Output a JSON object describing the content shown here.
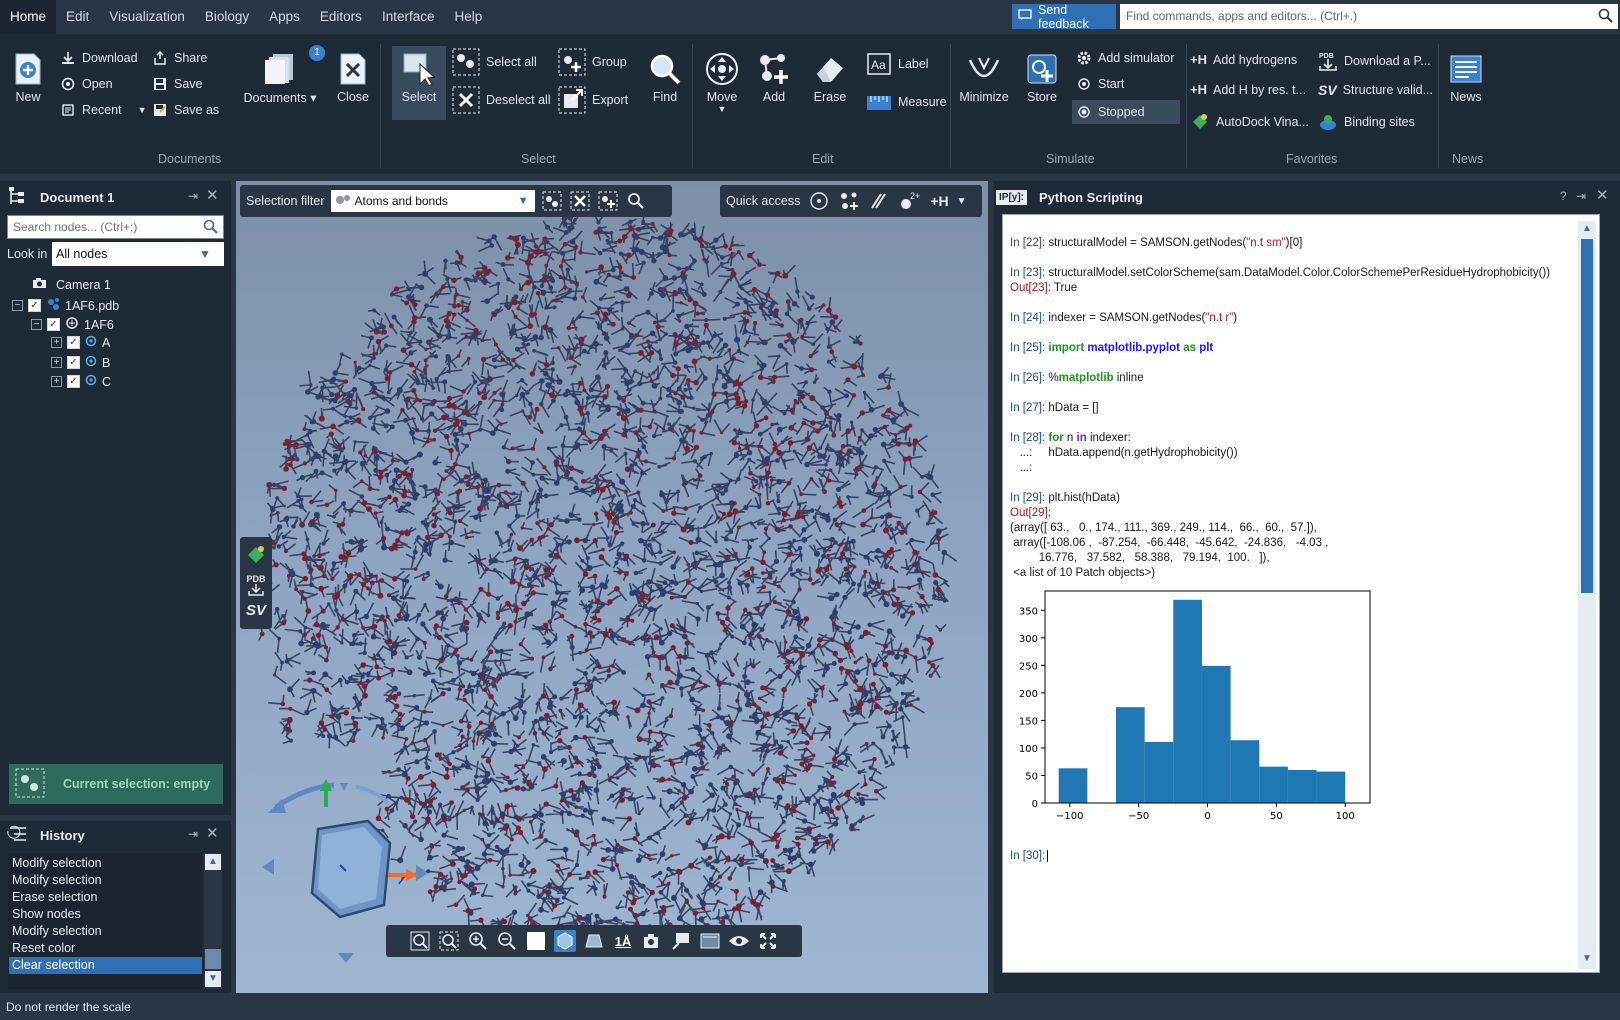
{
  "menubar": {
    "items": [
      "Home",
      "Edit",
      "Visualization",
      "Biology",
      "Apps",
      "Editors",
      "Interface",
      "Help"
    ],
    "active": "Home"
  },
  "feedback_label": "Send feedback",
  "command_placeholder": "Find commands, apps and editors... (Ctrl+.)",
  "ribbon": {
    "documents": {
      "new": "New",
      "download": "Download",
      "open": "Open",
      "recent": "Recent",
      "share": "Share",
      "save": "Save",
      "save_as": "Save as",
      "documents": "Documents",
      "close": "Close",
      "badge": "1",
      "group": "Documents"
    },
    "select": {
      "select": "Select",
      "select_all": "Select all",
      "deselect_all": "Deselect all",
      "group_btn": "Group",
      "export": "Export",
      "find": "Find",
      "group": "Select"
    },
    "edit": {
      "move": "Move",
      "add": "Add",
      "erase": "Erase",
      "label": "Label",
      "measure": "Measure",
      "group": "Edit"
    },
    "simulate": {
      "minimize": "Minimize",
      "store": "Store",
      "add_simulator": "Add simulator",
      "start": "Start",
      "stopped": "Stopped",
      "group": "Simulate"
    },
    "favorites": {
      "add_hydrogens": "Add hydrogens",
      "add_h_res": "Add H by res. t...",
      "autodock": "AutoDock Vina...",
      "download_pdb": "Download a P...",
      "structure_valid": "Structure valid...",
      "binding_sites": "Binding sites",
      "group": "Favorites"
    },
    "news": {
      "news": "News",
      "group": "News"
    }
  },
  "document_panel": {
    "title": "Document 1",
    "search_placeholder": "Search nodes... (Ctrl+;)",
    "look_in_label": "Look in",
    "look_in_value": "All nodes",
    "tree": {
      "camera": "Camera 1",
      "file": "1AF6.pdb",
      "model": "1AF6",
      "chains": [
        "A",
        "B",
        "C"
      ]
    },
    "current_selection": "Current selection: empty"
  },
  "history_panel": {
    "title": "History",
    "items": [
      "Modify selection",
      "Modify selection",
      "Erase selection",
      "Show nodes",
      "Modify selection",
      "Reset color",
      "Clear selection"
    ],
    "selected_index": 6
  },
  "viewport": {
    "selection_filter_label": "Selection filter",
    "selection_filter_value": "Atoms and bonds",
    "quick_access_label": "Quick access",
    "quick_access_charge": "2+",
    "quick_access_h": "+H",
    "side_pdb": "PDB",
    "side_sv": "SV",
    "bottom_scale_label": "1Å"
  },
  "python_panel": {
    "title": "Python Scripting",
    "icon_text": "IP[y]:",
    "cells": {
      "c22": {
        "prompt": "In [22]:",
        "pre": " structuralModel = SAMSON.getNodes(",
        "str": "\"n.t sm\"",
        "post": ")[0]"
      },
      "c23": {
        "prompt": "In [23]:",
        "code": " structuralModel.setColorScheme(sam.DataModel.Color.ColorSchemePerResidueHydrophobicity())",
        "out_prompt": "Out[23]:",
        "out": " True"
      },
      "c24": {
        "prompt": "In [24]:",
        "pre": " indexer = SAMSON.getNodes(",
        "str": "\"n.t r\"",
        "post": ")"
      },
      "c25": {
        "prompt": "In [25]:",
        "kw1": "import",
        "mod": "matplotlib.pyplot",
        "kw2": "as",
        "alias": "plt"
      },
      "c26": {
        "prompt": "In [26]:",
        "pct": " %",
        "magic": "matplotlib",
        "rest": " inline"
      },
      "c27": {
        "prompt": "In [27]:",
        "code": " hData = []"
      },
      "c28": {
        "prompt": "In [28]:",
        "kw_for": "for",
        "var": " n ",
        "kw_in": "in",
        "rest": " indexer:",
        "line2": "   ...:     hData.append(n.getHydrophobicity())",
        "line3": "   ...:"
      },
      "c29": {
        "prompt": "In [29]:",
        "code": " plt.hist(hData)",
        "out_prompt": "Out[29]:",
        "out1": "(array([ 63.,   0., 174., 111., 369., 249., 114.,  66.,  60.,  57.]),",
        "out2": " array([-108.06 ,  -87.254,  -66.448,  -45.642,  -24.836,   -4.03 ,",
        "out3": "         16.776,   37.582,   58.388,   79.194,  100.   ]),",
        "out4": " <a list of 10 Patch objects>)"
      },
      "c30": {
        "prompt": "In [30]:"
      }
    }
  },
  "chart_data": {
    "type": "bar",
    "title": "",
    "xlabel": "",
    "ylabel": "",
    "bin_edges": [
      -108.06,
      -87.254,
      -66.448,
      -45.642,
      -24.836,
      -4.03,
      16.776,
      37.582,
      58.388,
      79.194,
      100.0
    ],
    "values": [
      63,
      0,
      174,
      111,
      369,
      249,
      114,
      66,
      60,
      57
    ],
    "xlim": [
      -118,
      118
    ],
    "ylim": [
      0,
      385
    ],
    "xticks": [
      -100,
      -50,
      0,
      50,
      100
    ],
    "yticks": [
      0,
      50,
      100,
      150,
      200,
      250,
      300,
      350
    ],
    "xtick_labels": [
      "−100",
      "−50",
      "0",
      "50",
      "100"
    ],
    "ytick_labels": [
      "0",
      "50",
      "100",
      "150",
      "200",
      "250",
      "300",
      "350"
    ],
    "color": "#1f77b4",
    "grid": false
  },
  "status_bar": "Do not render the scale",
  "colors": {
    "accent": "#2f6fb3",
    "panel": "#1f2a37",
    "selection_box": "#2e6b5d",
    "viewport_top": "#7d8fa9"
  }
}
